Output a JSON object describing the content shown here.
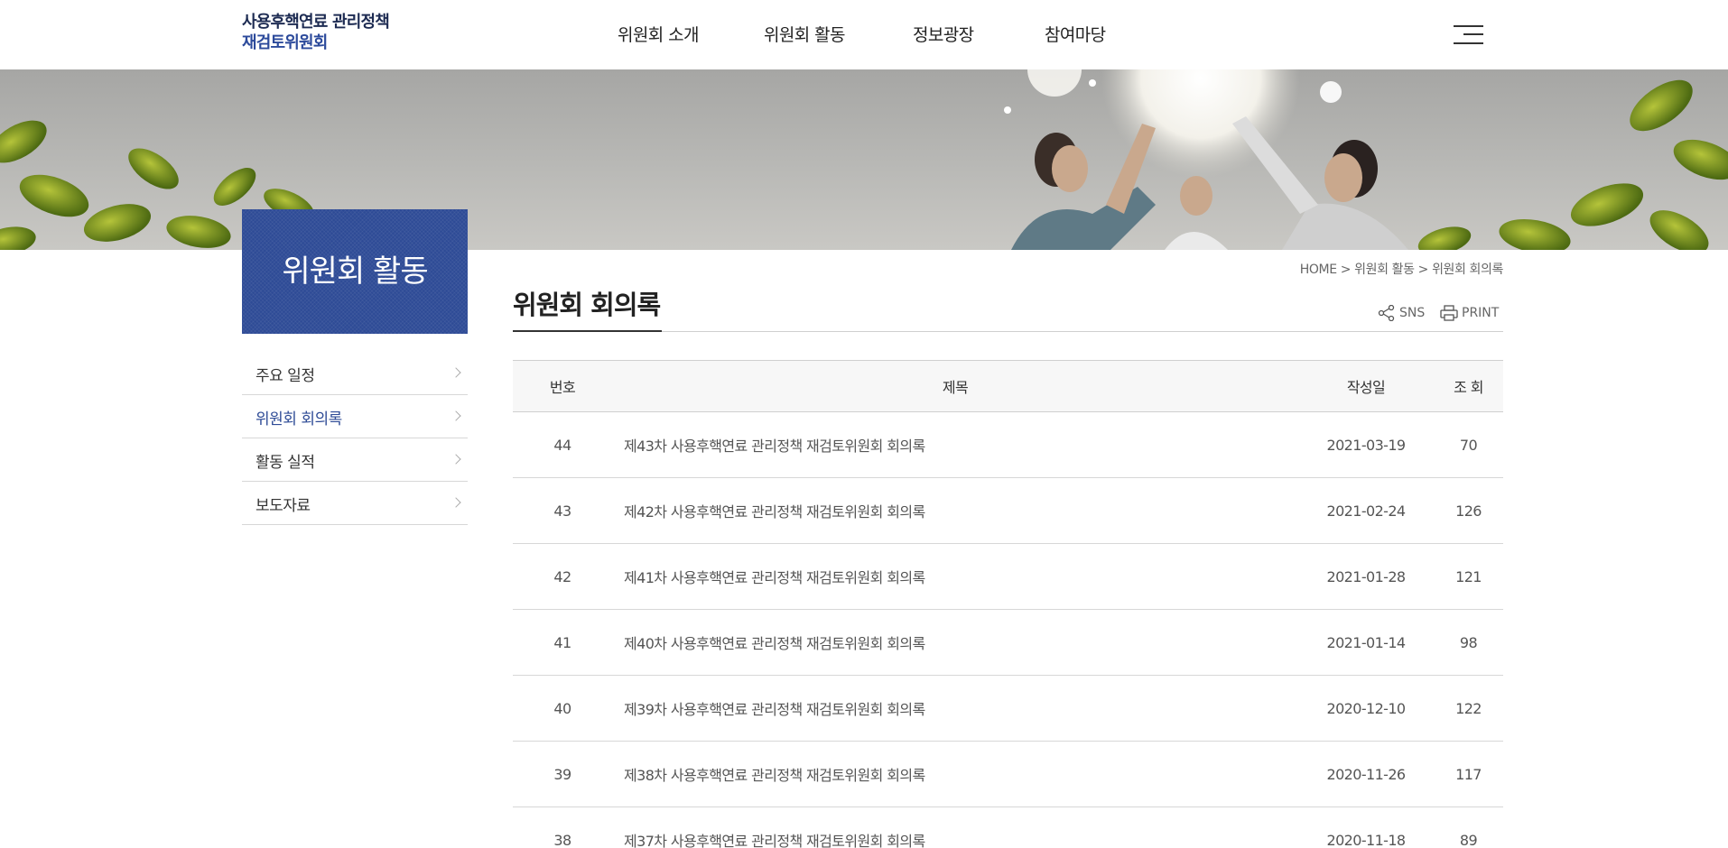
{
  "header": {
    "logo_line1": "사용후핵연료 관리정책",
    "logo_line2": "재검토위원회",
    "nav": [
      {
        "label": "위원회 소개"
      },
      {
        "label": "위원회 활동"
      },
      {
        "label": "정보광장"
      },
      {
        "label": "참여마당"
      }
    ],
    "menu_icon": "hamburger-icon"
  },
  "sidebar": {
    "title": "위원회 활동",
    "items": [
      {
        "label": "주요 일정",
        "active": false
      },
      {
        "label": "위원회 회의록",
        "active": true
      },
      {
        "label": "활동 실적",
        "active": false
      },
      {
        "label": "보도자료",
        "active": false
      }
    ]
  },
  "breadcrumb": {
    "home": "HOME",
    "sep": ">",
    "level1": "위원회 활동",
    "level2": "위원회 회의록"
  },
  "page": {
    "title": "위원회 회의록",
    "sns_label": "SNS",
    "print_label": "PRINT"
  },
  "board": {
    "columns": {
      "num": "번호",
      "title": "제목",
      "date": "작성일",
      "hits": "조 회"
    },
    "rows": [
      {
        "num": "44",
        "title": "제43차 사용후핵연료 관리정책 재검토위원회 회의록",
        "date": "2021-03-19",
        "hits": "70"
      },
      {
        "num": "43",
        "title": "제42차 사용후핵연료 관리정책 재검토위원회 회의록",
        "date": "2021-02-24",
        "hits": "126"
      },
      {
        "num": "42",
        "title": "제41차 사용후핵연료 관리정책 재검토위원회 회의록",
        "date": "2021-01-28",
        "hits": "121"
      },
      {
        "num": "41",
        "title": "제40차 사용후핵연료 관리정책 재검토위원회 회의록",
        "date": "2021-01-14",
        "hits": "98"
      },
      {
        "num": "40",
        "title": "제39차 사용후핵연료 관리정책 재검토위원회 회의록",
        "date": "2020-12-10",
        "hits": "122"
      },
      {
        "num": "39",
        "title": "제38차 사용후핵연료 관리정책 재검토위원회 회의록",
        "date": "2020-11-26",
        "hits": "117"
      },
      {
        "num": "38",
        "title": "제37차 사용후핵연료 관리정책 재검토위원회 회의록",
        "date": "2020-11-18",
        "hits": "89"
      }
    ]
  },
  "colors": {
    "brand_navy": "#1d2b52",
    "brand_blue": "#2e4b96",
    "line": "#cfcfcf"
  }
}
